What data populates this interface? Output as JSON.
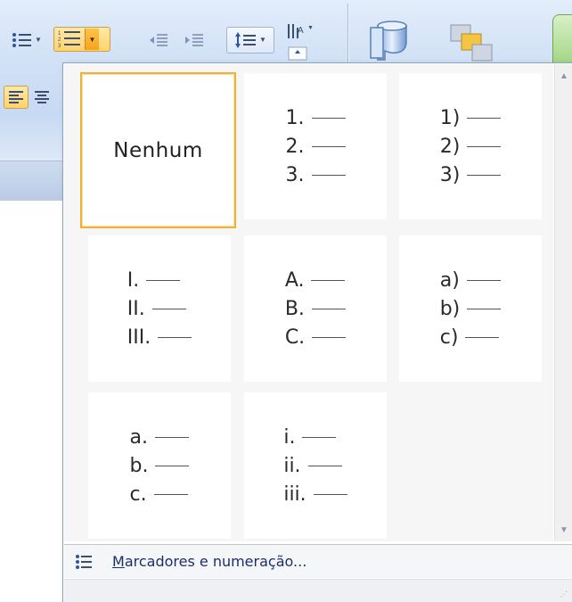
{
  "ribbon": {
    "buttons": [
      {
        "name": "bullets-button",
        "icon": "bullet-list-icon"
      },
      {
        "name": "numbering-button",
        "icon": "numbered-list-icon",
        "active": true
      },
      {
        "name": "decrease-indent-button",
        "icon": "decrease-indent-icon"
      },
      {
        "name": "increase-indent-button",
        "icon": "increase-indent-icon"
      },
      {
        "name": "line-spacing-button",
        "icon": "line-spacing-icon"
      },
      {
        "name": "text-direction-button",
        "icon": "text-direction-icon"
      },
      {
        "name": "shapes-button",
        "icon": "shapes-icon"
      },
      {
        "name": "arrange-button",
        "icon": "arrange-icon"
      },
      {
        "name": "align-left-button",
        "icon": "align-left-icon",
        "active": true
      },
      {
        "name": "align-center-button",
        "icon": "align-center-icon"
      }
    ]
  },
  "numbering_gallery": {
    "none_label": "Nenhum",
    "formats": [
      {
        "id": "none",
        "lines": []
      },
      {
        "id": "decimal-period",
        "lines": [
          "1.",
          "2.",
          "3."
        ]
      },
      {
        "id": "decimal-paren",
        "lines": [
          "1)",
          "2)",
          "3)"
        ]
      },
      {
        "id": "upper-roman",
        "lines": [
          "I.",
          "II.",
          "III."
        ]
      },
      {
        "id": "upper-alpha",
        "lines": [
          "A.",
          "B.",
          "C."
        ]
      },
      {
        "id": "lower-alpha-paren",
        "lines": [
          "a)",
          "b)",
          "c)"
        ]
      },
      {
        "id": "lower-alpha-period",
        "lines": [
          "a.",
          "b.",
          "c."
        ]
      },
      {
        "id": "lower-roman",
        "lines": [
          "i.",
          "ii.",
          "iii."
        ]
      }
    ],
    "selected": "none"
  },
  "footer": {
    "mnemonic": "M",
    "label_rest": "arcadores e numeração...",
    "icon": "bullet-list-icon"
  },
  "colors": {
    "selection_border": "#f0b13b",
    "active_button": "#ffd36b",
    "link_text": "#1a2f6b"
  }
}
